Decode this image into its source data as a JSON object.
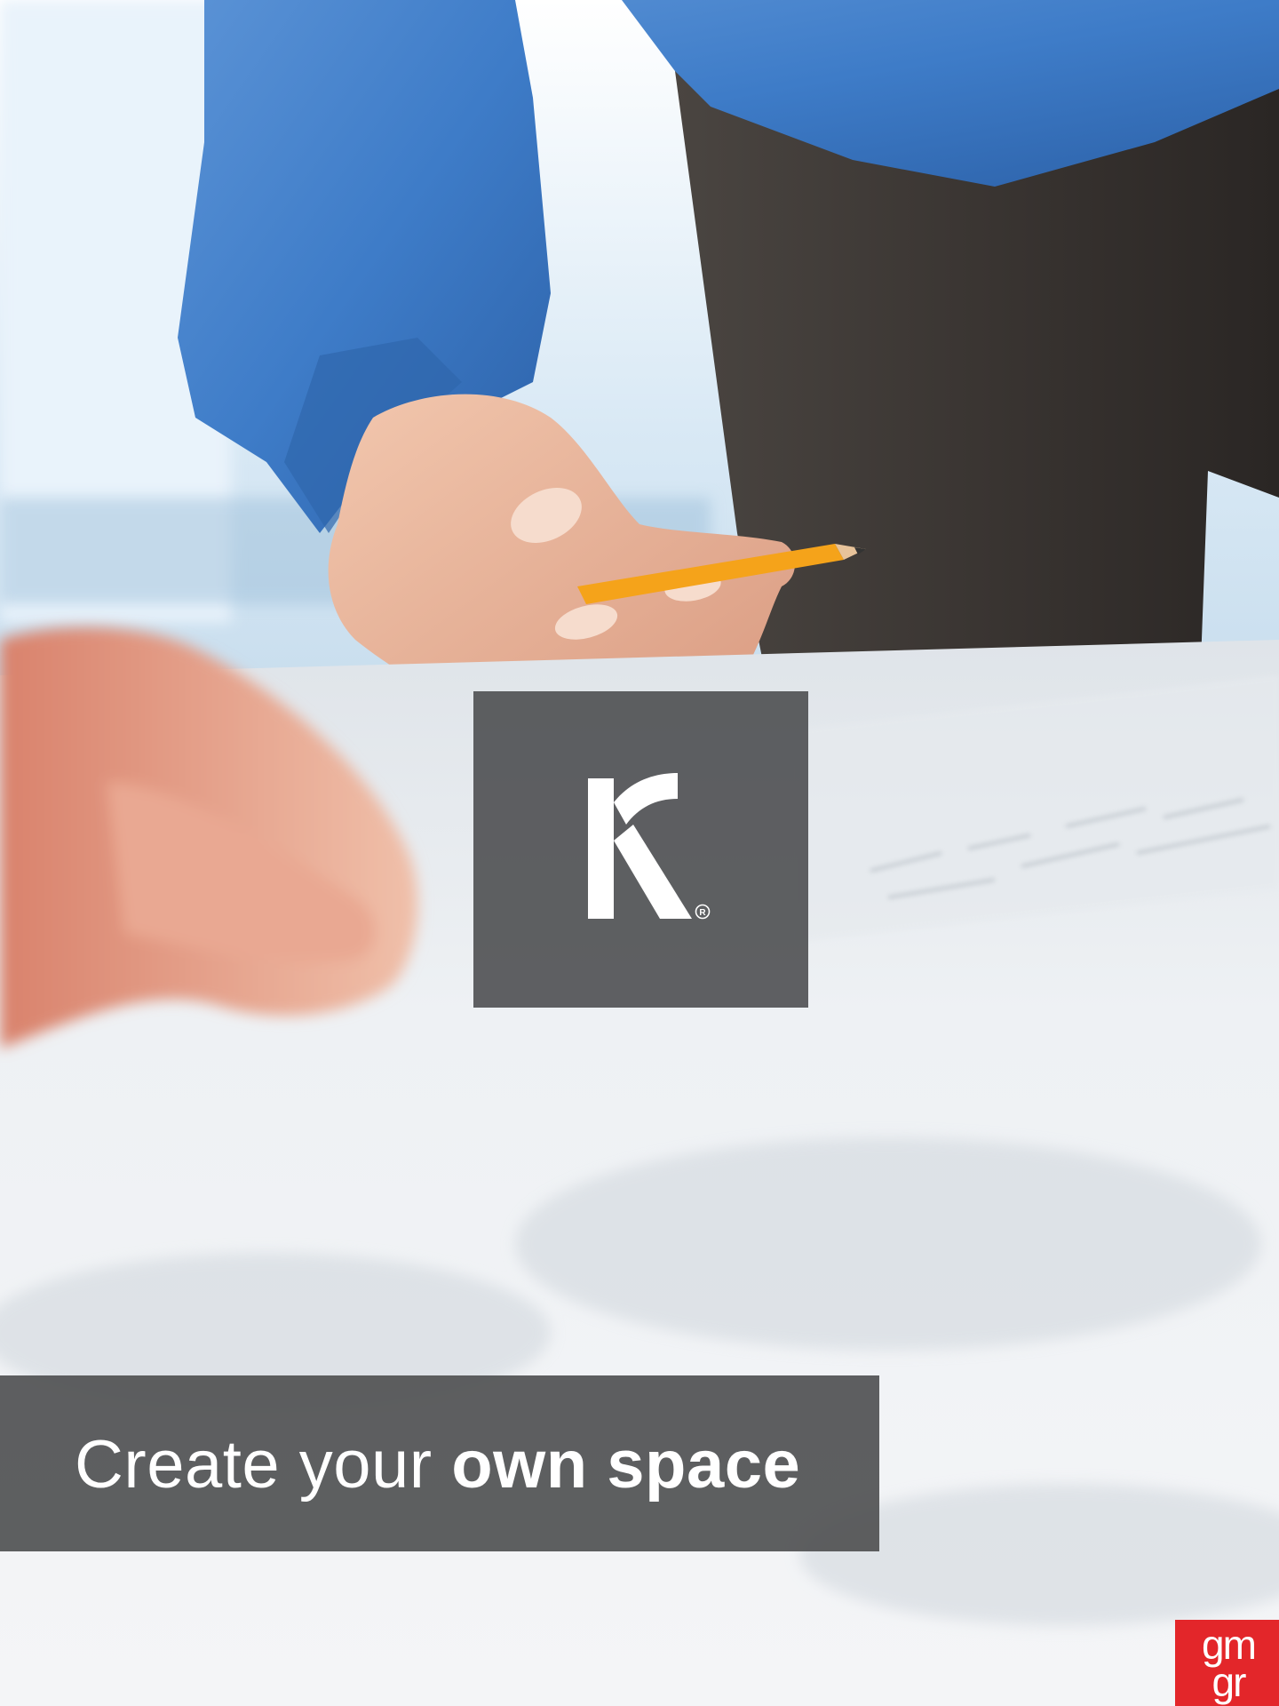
{
  "tagline": {
    "light": "Create your",
    "bold": "own space"
  },
  "logo": {
    "letter": "K",
    "registered": "®"
  },
  "badge": {
    "line1": "gm",
    "line2": "gr",
    "color": "#e3262a"
  },
  "colors": {
    "shirt": "#3e7cc8",
    "trousers": "#3e3a37",
    "overlay": "#4f5052",
    "pencil": "#f5a31a"
  }
}
